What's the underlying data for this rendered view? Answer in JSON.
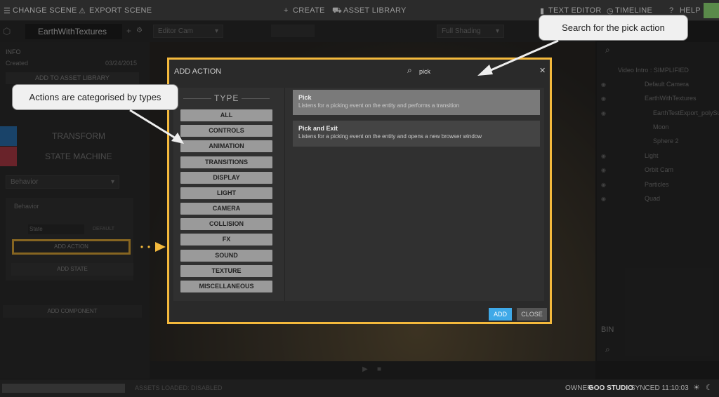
{
  "topbar": {
    "change_scene": "CHANGE SCENE",
    "export_scene": "EXPORT SCENE",
    "create": "CREATE",
    "asset_library": "ASSET LIBRARY",
    "text_editor": "TEXT EDITOR",
    "timeline": "TIMELINE",
    "help": "HELP"
  },
  "secbar": {
    "scene_name": "EarthWithTextures",
    "camera": "Editor Cam",
    "shading": "Full Shading"
  },
  "left": {
    "info_header": "INFO",
    "created_label": "Created",
    "created_date": "03/24/2015",
    "add_to_asset_library": "ADD TO ASSET LIBRARY",
    "transform": "TRANSFORM",
    "state_machine": "STATE MACHINE",
    "behavior_select": "Behavior",
    "behavior_title": "Behavior",
    "state_name": "State",
    "default_label": "DEFAULT",
    "add_action": "ADD ACTION",
    "add_state": "ADD STATE",
    "add_component": "ADD COMPONENT"
  },
  "right": {
    "tree": [
      "Video Intro : SIMPLIFIED",
      "Default Camera",
      "EarthWithTextures",
      "EarthTestExport_polySu",
      "Moon",
      "Sphere 2",
      "Light",
      "Orbit Cam",
      "Particles",
      "Quad"
    ],
    "bin": "BIN"
  },
  "bottombar": {
    "status": "ASSETS LOADED: DISABLED",
    "owner_label": "OWNER",
    "owner_name": "GOO STUDIO",
    "synced": "SYNCED 11:10:03"
  },
  "modal": {
    "title": "ADD ACTION",
    "search_value": "pick",
    "type_header": "TYPE",
    "types": [
      "ALL",
      "CONTROLS",
      "ANIMATION",
      "TRANSITIONS",
      "DISPLAY",
      "LIGHT",
      "CAMERA",
      "COLLISION",
      "FX",
      "SOUND",
      "TEXTURE",
      "MISCELLANEOUS"
    ],
    "results": [
      {
        "title": "Pick",
        "desc": "Listens for a picking event on the entity and performs a transition"
      },
      {
        "title": "Pick and Exit",
        "desc": "Listens for a picking event on the entity and opens a new browser window"
      }
    ],
    "add_button": "ADD",
    "close_button": "CLOSE"
  },
  "tooltips": {
    "search": "Search for the pick action",
    "types": "Actions are categorised by types"
  },
  "colors": {
    "highlight": "#f4b93c",
    "accent_blue": "#3fa9e8",
    "transform_tab": "#2e7bbf",
    "state_machine_tab": "#c0404e"
  }
}
